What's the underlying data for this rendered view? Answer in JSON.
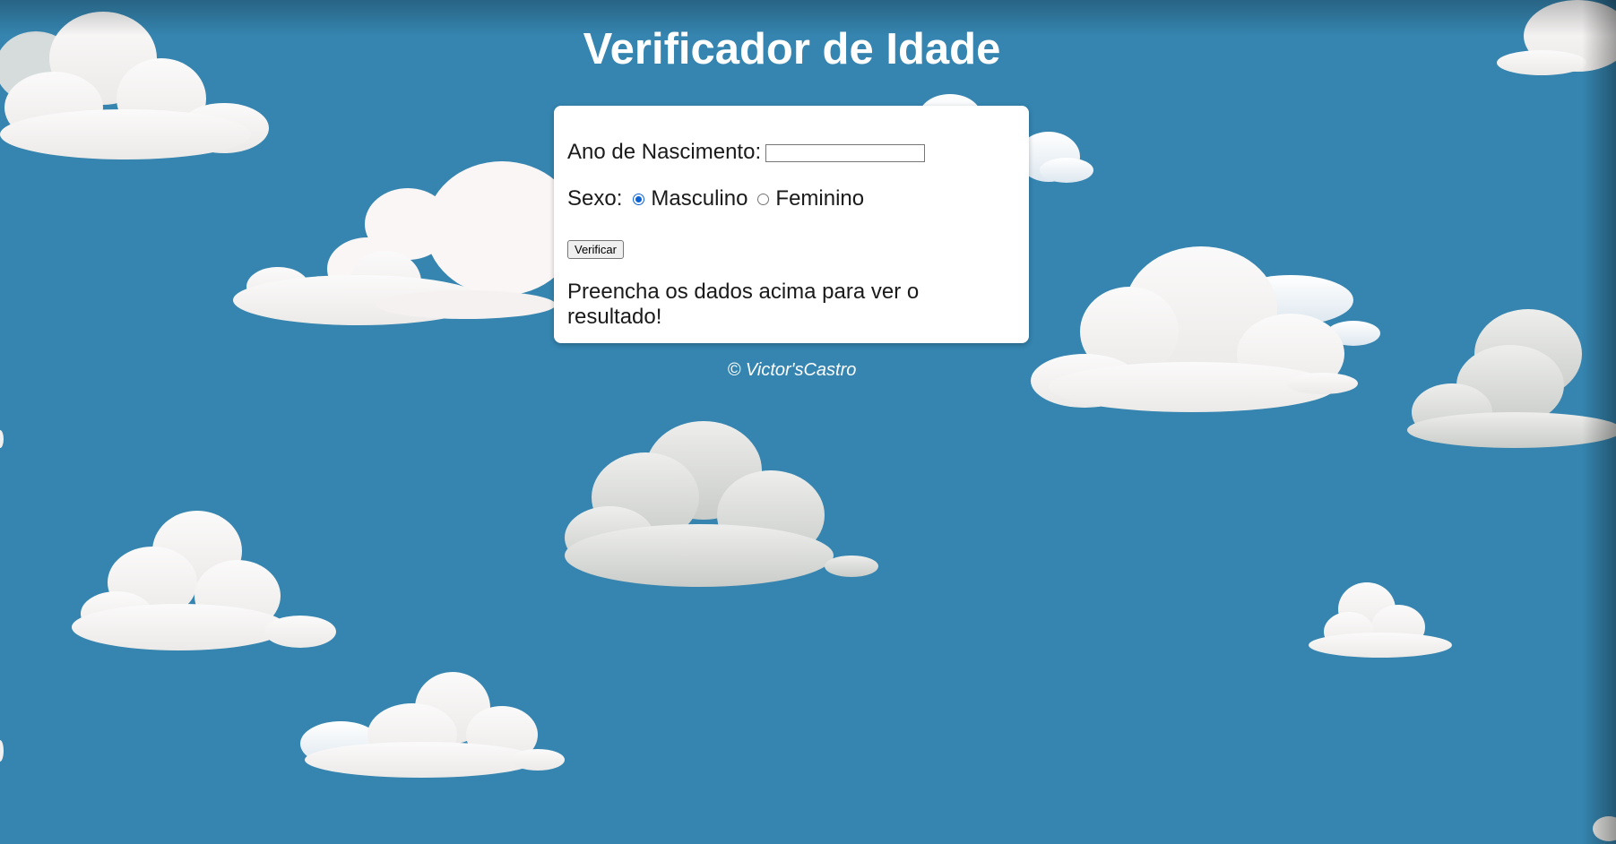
{
  "page": {
    "title": "Verificador de Idade",
    "background_color": "#3585b0"
  },
  "form": {
    "year_label": "Ano de Nascimento:",
    "year_value": "",
    "sex_label": "Sexo:",
    "sex_options": [
      {
        "label": "Masculino",
        "checked": true
      },
      {
        "label": "Feminino",
        "checked": false
      }
    ],
    "verify_label": "Verificar",
    "result_text": "Preencha os dados acima para ver o resultado!"
  },
  "footer": {
    "text": "© Victor'sCastro"
  }
}
